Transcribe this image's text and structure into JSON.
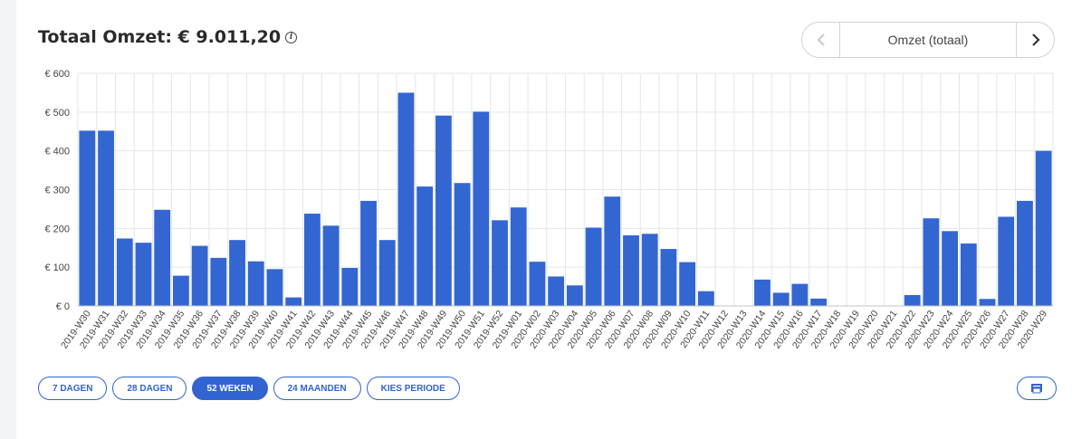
{
  "header": {
    "title": "Totaal Omzet: € 9.011,20",
    "info_icon": "info-icon"
  },
  "selector": {
    "label": "Omzet (totaal)",
    "prev_icon": "chevron-left-icon",
    "next_icon": "chevron-right-icon"
  },
  "periods": {
    "items": [
      {
        "label": "7 DAGEN",
        "active": false
      },
      {
        "label": "28 DAGEN",
        "active": false
      },
      {
        "label": "52 WEKEN",
        "active": true
      },
      {
        "label": "24 MAANDEN",
        "active": false
      },
      {
        "label": "KIES PERIODE",
        "active": false
      }
    ]
  },
  "print_icon": "print-icon",
  "colors": {
    "bar": "#3366d1",
    "accent": "#3164d0",
    "grid": "#e4e6e9"
  },
  "chart_data": {
    "type": "bar",
    "ylim": [
      0,
      600
    ],
    "yticks": [
      {
        "value": 0,
        "label": "€ 0"
      },
      {
        "value": 100,
        "label": "€ 100"
      },
      {
        "value": 200,
        "label": "€ 200"
      },
      {
        "value": 300,
        "label": "€ 300"
      },
      {
        "value": 400,
        "label": "€ 400"
      },
      {
        "value": 500,
        "label": "€ 500"
      },
      {
        "value": 600,
        "label": "€ 600"
      }
    ],
    "grid": true,
    "legend": false,
    "categories": [
      "2019-W30",
      "2019-W31",
      "2019-W32",
      "2019-W33",
      "2019-W34",
      "2019-W35",
      "2019-W36",
      "2019-W37",
      "2019-W38",
      "2019-W39",
      "2019-W40",
      "2019-W41",
      "2019-W42",
      "2019-W43",
      "2019-W44",
      "2019-W45",
      "2019-W46",
      "2019-W47",
      "2019-W48",
      "2019-W49",
      "2019-W50",
      "2019-W51",
      "2019-W52",
      "2019-W01",
      "2020-W02",
      "2020-W03",
      "2020-W04",
      "2020-W05",
      "2020-W06",
      "2020-W07",
      "2020-W08",
      "2020-W09",
      "2020-W10",
      "2020-W11",
      "2020-W12",
      "2020-W13",
      "2020-W14",
      "2020-W15",
      "2020-W16",
      "2020-W17",
      "2020-W18",
      "2020-W19",
      "2020-W20",
      "2020-W21",
      "2020-W22",
      "2020-W23",
      "2020-W24",
      "2020-W25",
      "2020-W26",
      "2020-W27",
      "2020-W28",
      "2020-W29"
    ],
    "values": [
      452,
      452,
      174,
      163,
      248,
      78,
      155,
      124,
      170,
      115,
      95,
      22,
      238,
      207,
      98,
      271,
      170,
      550,
      308,
      491,
      317,
      501,
      221,
      254,
      114,
      76,
      53,
      202,
      282,
      182,
      186,
      147,
      113,
      38,
      0,
      0,
      68,
      34,
      57,
      19,
      0,
      0,
      0,
      0,
      28,
      226,
      193,
      161,
      18,
      230,
      271,
      400
    ]
  }
}
